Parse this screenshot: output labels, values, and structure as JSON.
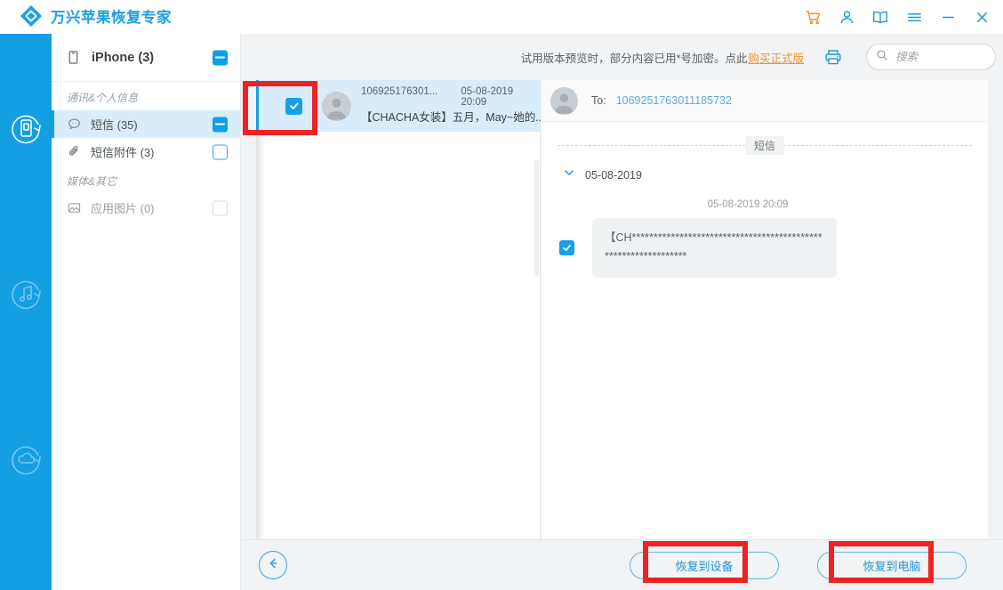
{
  "app": {
    "title": "万兴苹果恢复专家",
    "logo_icon": "wondershare-diamond-logo"
  },
  "titlebar": {
    "buttons": [
      {
        "name": "cart-icon",
        "label": "购物车",
        "color": "#f0922b"
      },
      {
        "name": "account-icon",
        "label": "账户",
        "color": "#2196d6"
      },
      {
        "name": "book-icon",
        "label": "帮助手册",
        "color": "#2196d6"
      },
      {
        "name": "menu-icon",
        "label": "菜单",
        "color": "#2196d6"
      },
      {
        "name": "minimize-icon",
        "label": "最小化",
        "color": "#2196d6"
      },
      {
        "name": "close-icon",
        "label": "关闭",
        "color": "#2196d6"
      }
    ]
  },
  "rail": {
    "items": [
      {
        "name": "recover-from-device-icon",
        "label": "从iOS设备恢复",
        "active": true
      },
      {
        "name": "recover-music-icon",
        "label": "从iTunes备份恢复",
        "active": false
      },
      {
        "name": "recover-from-cloud-icon",
        "label": "从iCloud恢复",
        "active": false
      }
    ]
  },
  "sidebar": {
    "device": {
      "label": "iPhone (3)",
      "icon": "phone-icon",
      "checkbox": "indeterminate"
    },
    "groups": [
      {
        "label": "通讯&个人信息",
        "items": [
          {
            "label": "短信 (35)",
            "icon": "message-icon",
            "checkbox": "indeterminate",
            "active": true
          },
          {
            "label": "短信附件 (3)",
            "icon": "attachment-icon",
            "checkbox": "empty",
            "active": false
          }
        ]
      },
      {
        "label": "媒体&其它",
        "items": [
          {
            "label": "应用图片 (0)",
            "icon": "image-icon",
            "checkbox": "faded",
            "active": false
          }
        ]
      }
    ]
  },
  "topbar": {
    "trial_notice": "试用版本预览时，部分内容已用*号加密。点此",
    "trial_link": "购买正式版",
    "print_icon": "printer-icon",
    "search": {
      "icon": "search-icon",
      "value": "",
      "placeholder": "搜索"
    }
  },
  "list": {
    "items": [
      {
        "sender": "106925176301...",
        "time": "05-08-2019 20:09",
        "snippet": "【CHACHA女装】五月，May~她的...",
        "checked": true,
        "selected": true,
        "avatar_icon": "person-avatar-icon"
      }
    ]
  },
  "detail": {
    "to_label": "To:",
    "to_number": "1069251763011185732",
    "avatar_icon": "person-avatar-icon",
    "section_label": "短信",
    "date_group": {
      "date": "05-08-2019",
      "expanded": true,
      "chevron_icon": "chevron-down-icon"
    },
    "messages": [
      {
        "time": "05-08-2019 20:09",
        "text": "【CH***************************************************************",
        "checked": true
      }
    ]
  },
  "footer": {
    "back_icon": "arrow-left-icon",
    "buttons": [
      {
        "label": "恢复到设备",
        "name": "restore-to-device-button"
      },
      {
        "label": "恢复到电脑",
        "name": "restore-to-computer-button"
      }
    ]
  },
  "colors": {
    "accent": "#159fe3",
    "link": "#f0922b",
    "selected_row": "#d9ecfa",
    "annotation": "#ee2222"
  }
}
